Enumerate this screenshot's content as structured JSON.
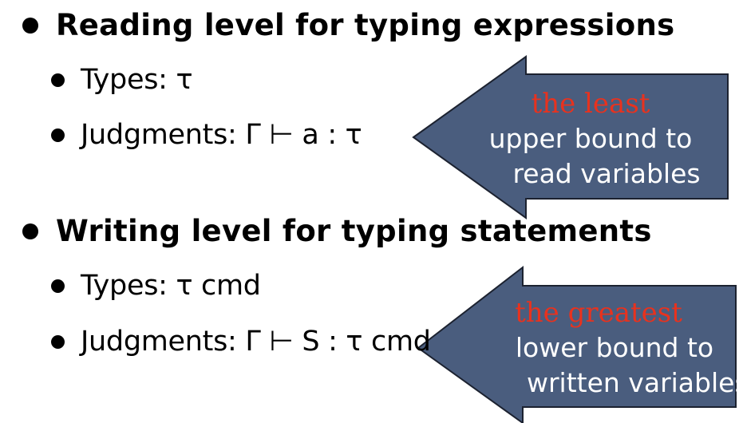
{
  "bullets": {
    "reading": {
      "title": "Reading level for typing expressions",
      "types": "Types: τ",
      "judgments": "Judgments:  Γ ⊢ a : τ"
    },
    "writing": {
      "title": "Writing level for typing statements",
      "types": "Types: τ cmd",
      "judgments": "Judgments: Γ ⊢ S : τ cmd"
    }
  },
  "callouts": {
    "read": {
      "highlight": "the least",
      "line1": "upper bound to",
      "line2": "read variables"
    },
    "write": {
      "highlight": "the greatest",
      "line1": "lower bound to",
      "line2": "written variables"
    }
  },
  "colors": {
    "arrow_fill": "#4a5d7e",
    "arrow_stroke": "#1c2230",
    "highlight": "#e8321e",
    "text": "#000000",
    "callout_text": "#ffffff"
  }
}
